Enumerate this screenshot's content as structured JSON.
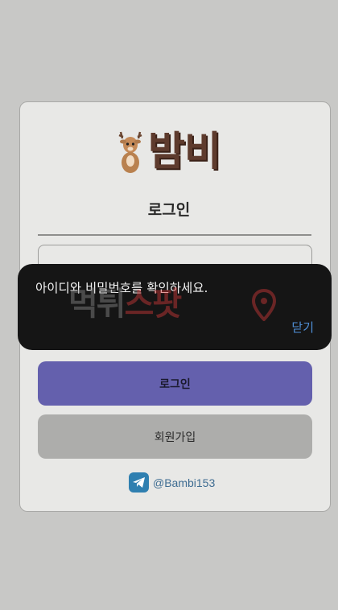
{
  "brand": {
    "name": "밤비"
  },
  "login_form": {
    "title": "로그인",
    "login_button": "로그인",
    "signup_button": "회원가입"
  },
  "contact": {
    "telegram_handle": "@Bambi153"
  },
  "dialog": {
    "message": "아이디와 비밀번호를 확인하세요.",
    "close_label": "닫기"
  },
  "watermark": {
    "part1": "먹튀",
    "part2": "스팟"
  },
  "colors": {
    "primary_button": "#6460ad",
    "dialog_bg": "#151515",
    "dialog_link": "#4f8fd6",
    "brand_brown": "#5e3b2d"
  }
}
